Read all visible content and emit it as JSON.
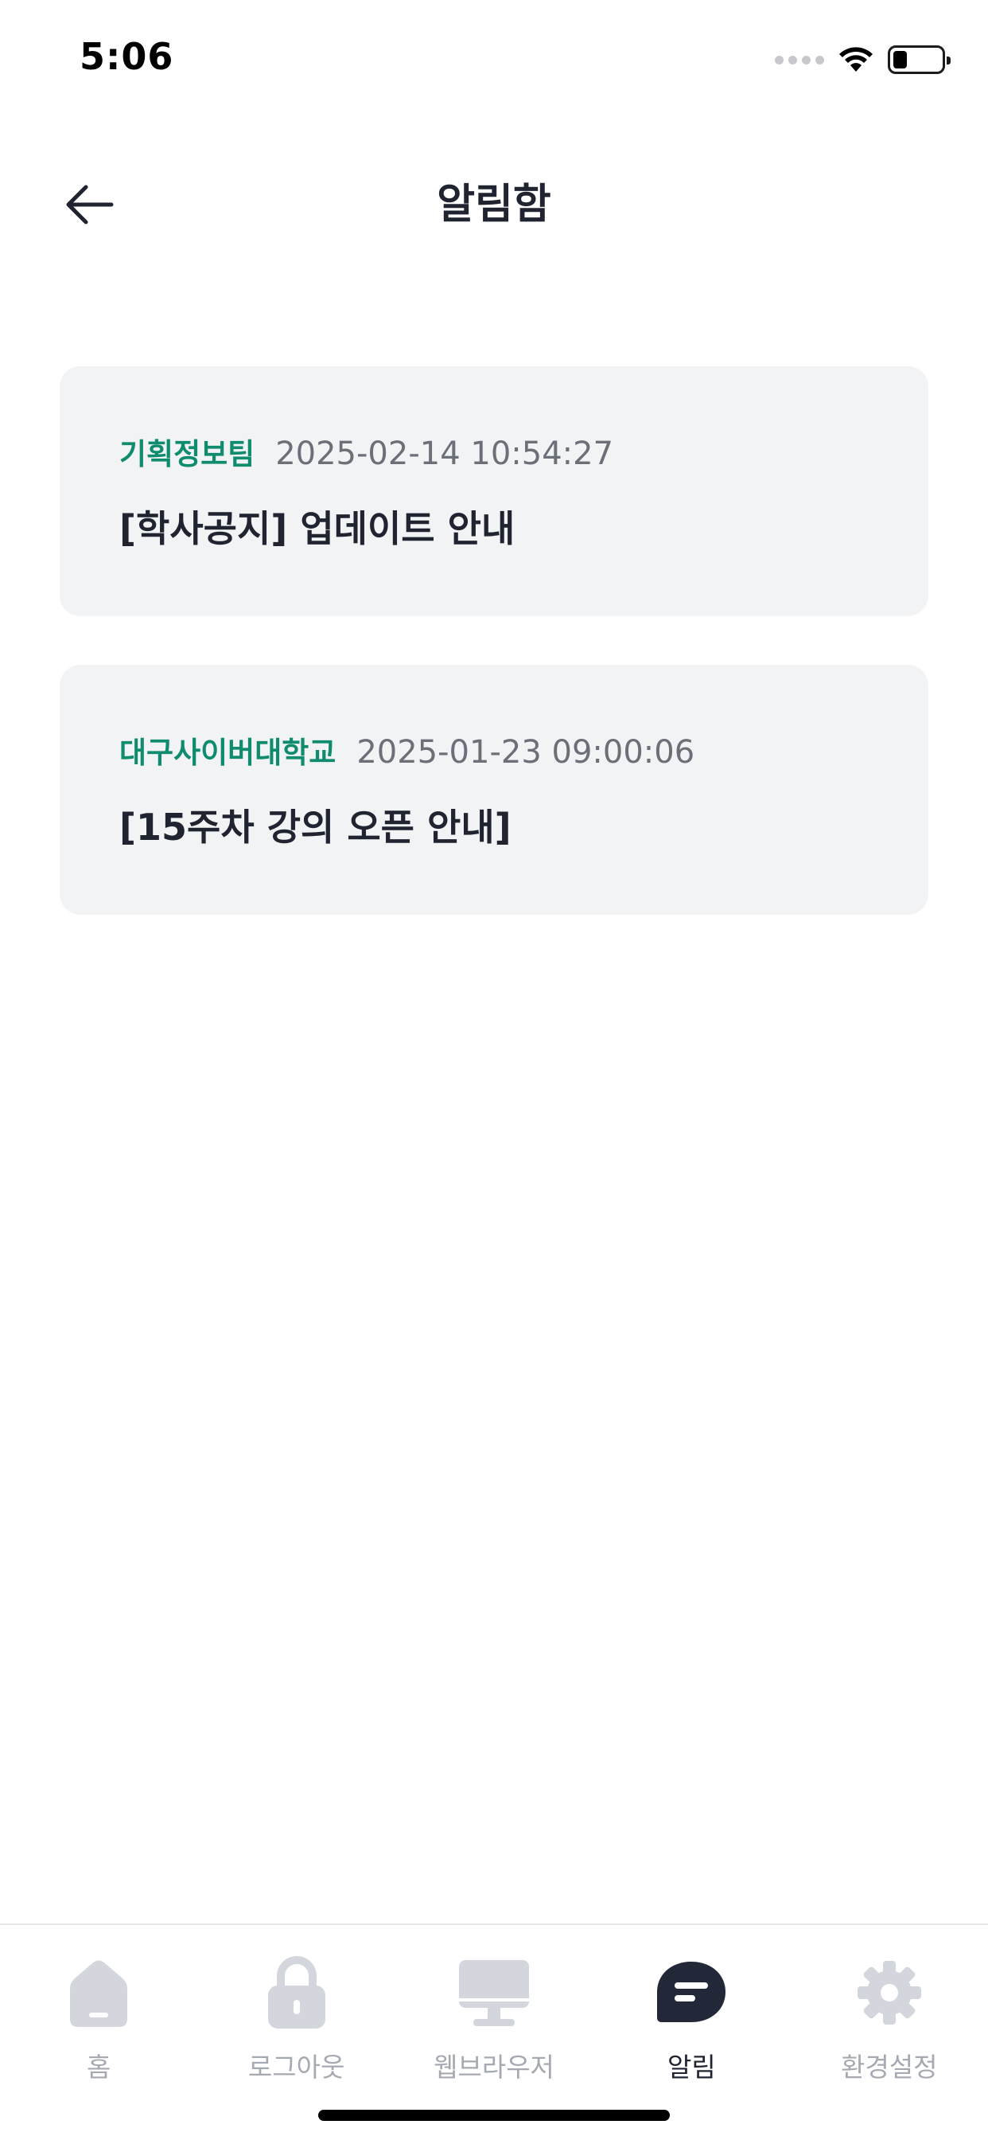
{
  "status_bar": {
    "time": "5:06",
    "battery_level": 0.3
  },
  "header": {
    "title": "알림함",
    "back_icon": "arrow-left-icon"
  },
  "notifications": [
    {
      "sender": "기획정보팀",
      "date": "2025-02-14 10:54:27",
      "title": "[학사공지] 업데이트 안내"
    },
    {
      "sender": "대구사이버대학교",
      "date": "2025-01-23 09:00:06",
      "title": "[15주차 강의 오픈 안내]"
    }
  ],
  "tab_bar": {
    "items": [
      {
        "label": "홈",
        "icon": "home-icon",
        "active": false
      },
      {
        "label": "로그아웃",
        "icon": "lock-icon",
        "active": false
      },
      {
        "label": "웹브라우저",
        "icon": "monitor-icon",
        "active": false
      },
      {
        "label": "알림",
        "icon": "notice-icon",
        "active": true
      },
      {
        "label": "환경설정",
        "icon": "gear-icon",
        "active": false
      }
    ]
  },
  "colors": {
    "accent_green": "#0f8c6e",
    "card_background": "#f2f3f5",
    "inactive_icon": "#d3d6dc",
    "active_icon": "#232838"
  }
}
